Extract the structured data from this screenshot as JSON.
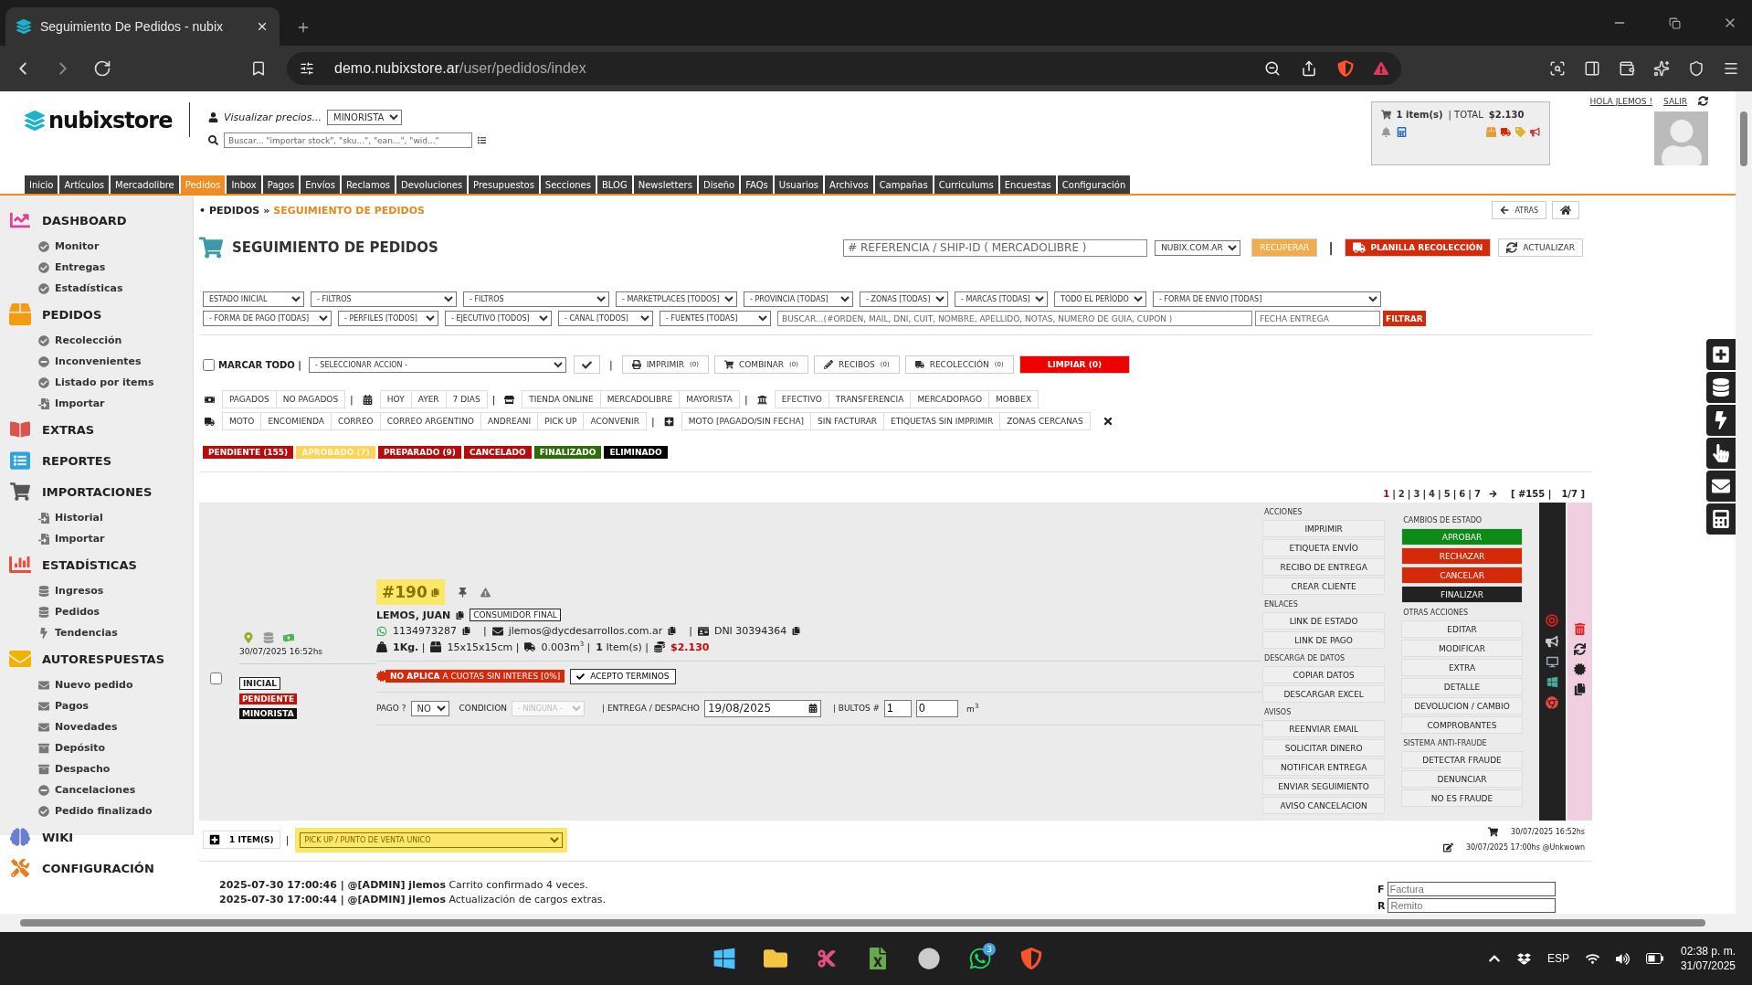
{
  "browser": {
    "tab_title": "Seguimiento De Pedidos - nubix",
    "url_host": "demo.nubixstore.ar",
    "url_path": "/user/pedidos/index"
  },
  "header": {
    "logo": "nubixstore",
    "price_label": "Visualizar precios...",
    "price_option": "MINORISTA",
    "search_placeholder": "Buscar... \"importar stock\", \"sku...\", \"ean...\", \"wid...\"",
    "cart_items": "1 item(s)",
    "cart_total_label": "| TOTAL",
    "cart_total": "$2.130",
    "user_links": [
      "HOLA JLEMOS !",
      "SALIR"
    ]
  },
  "nav": [
    {
      "label": "Inicio",
      "selected": false
    },
    {
      "label": "Artículos",
      "selected": false
    },
    {
      "label": "Mercadolibre",
      "selected": false
    },
    {
      "label": "Pedidos",
      "selected": true
    },
    {
      "label": "Inbox",
      "selected": false
    },
    {
      "label": "Pagos",
      "selected": false
    },
    {
      "label": "Envíos",
      "selected": false
    },
    {
      "label": "Reclamos",
      "selected": false
    },
    {
      "label": "Devoluciones",
      "selected": false
    },
    {
      "label": "Presupuestos",
      "selected": false
    },
    {
      "label": "Secciones",
      "selected": false
    },
    {
      "label": "BLOG",
      "selected": false
    },
    {
      "label": "Newsletters",
      "selected": false
    },
    {
      "label": "Diseño",
      "selected": false
    },
    {
      "label": "FAQs",
      "selected": false
    },
    {
      "label": "Usuarios",
      "selected": false
    },
    {
      "label": "Archivos",
      "selected": false
    },
    {
      "label": "Campañas",
      "selected": false
    },
    {
      "label": "Curriculums",
      "selected": false
    },
    {
      "label": "Encuestas",
      "selected": false
    },
    {
      "label": "Configuración",
      "selected": false
    }
  ],
  "sidebar": [
    {
      "title": "DASHBOARD",
      "kind": "dashboard",
      "items": [
        {
          "label": "Monitor",
          "kind": "check"
        },
        {
          "label": "Entregas",
          "kind": "check"
        },
        {
          "label": "Estadísticas",
          "kind": "check"
        }
      ]
    },
    {
      "title": "PEDIDOS",
      "kind": "box",
      "items": [
        {
          "label": "Recolección",
          "kind": "check"
        },
        {
          "label": "Inconvenientes",
          "kind": "minus"
        },
        {
          "label": "Listado por items",
          "kind": "check"
        },
        {
          "label": "Importar",
          "kind": "doc"
        }
      ]
    },
    {
      "title": "EXTRAS",
      "kind": "book"
    },
    {
      "title": "REPORTES",
      "kind": "report"
    },
    {
      "title": "IMPORTACIONES",
      "kind": "cart",
      "items": [
        {
          "label": "Historial",
          "kind": "doc"
        },
        {
          "label": "Importar",
          "kind": "doc"
        }
      ]
    },
    {
      "title": "ESTADÍSTICAS",
      "kind": "chart",
      "items": [
        {
          "label": "Ingresos",
          "kind": "stack"
        },
        {
          "label": "Pedidos",
          "kind": "stack"
        },
        {
          "label": "Tendencias",
          "kind": "bolt"
        }
      ]
    },
    {
      "title": "AUTORESPUESTAS",
      "kind": "mail",
      "items": [
        {
          "label": "Nuevo pedido",
          "kind": "mail"
        },
        {
          "label": "Pagos",
          "kind": "mail"
        },
        {
          "label": "Novedades",
          "kind": "mail"
        },
        {
          "label": "Depósito",
          "kind": "box"
        },
        {
          "label": "Despacho",
          "kind": "box"
        },
        {
          "label": "Cancelaciones",
          "kind": "minus"
        },
        {
          "label": "Pedido finalizado",
          "kind": "check"
        }
      ]
    },
    {
      "title": "WIKI",
      "kind": "brain"
    },
    {
      "title": "CONFIGURACIÓN",
      "kind": "tools"
    }
  ],
  "breadcrumb": {
    "bullet": "•",
    "parent": "PEDIDOS",
    "separator": "»",
    "current": "SEGUIMIENTO DE PEDIDOS",
    "back": "ATRAS"
  },
  "title": "SEGUIMIENTO DE PEDIDOS",
  "reference": {
    "placeholder": "# REFERENCIA / SHIP-ID ( MERCADOLIBRE )",
    "site": "NUBIX.COM.AR",
    "recover": "RECUPERAR",
    "separator": "|",
    "pickup_sheet": "PLANILLA RECOLECCIÓN",
    "refresh": "ACTUALIZAR"
  },
  "filters_row1": [
    "ESTADO INICIAL",
    "- FILTROS",
    "- FILTROS",
    "- MARKETPLACES [TODOS]",
    "- PROVINCIA [TODAS]",
    "- ZONAS [TODAS]",
    "- MARCAS [TODAS]",
    "TODO EL PERÍODO",
    "- FORMA DE ENVIO [TODAS]"
  ],
  "filters_row2": [
    "- FORMA DE PAGO [TODAS]",
    "- PERFILES [TODOS]",
    "- EJECUTIVO [TODOS]",
    "- CANAL [TODOS]",
    "- FUENTES [TODAS]"
  ],
  "search_placeholder": "BUSCAR...(#ORDEN, MAIL, DNI, CUIT, NOMBRE, APELLIDO, NOTAS, NUMERO DE GUIA, CUPON )",
  "date_placeholder": "FECHA ENTREGA",
  "filter_button": "FILTRAR",
  "bulk": {
    "select_all": "MARCAR TODO |",
    "checked": false,
    "action": "- SELECCIONAR ACCION -",
    "separator": "|",
    "buttons": [
      {
        "kind": "print",
        "label": "IMPRIMIR",
        "count": "(0)"
      },
      {
        "kind": "combine",
        "label": "COMBINAR",
        "count": "(0)"
      },
      {
        "kind": "receipt",
        "label": "RECIBOS",
        "count": "(0)"
      },
      {
        "kind": "truck",
        "label": "RECOLECCIÓN",
        "count": "(0)"
      }
    ],
    "clear": "LIMPIAR (0)"
  },
  "quick_filters": [
    [
      {
        "kind": "money",
        "buttons": [
          "PAGADOS",
          "NO PAGADOS"
        ]
      },
      {
        "kind": "calendar",
        "lead": "|",
        "buttons": [
          "HOY",
          "AYER",
          "7 DIAS"
        ]
      },
      {
        "kind": "store",
        "lead": "|",
        "buttons": [
          "TIENDA ONLINE",
          "MERCADOLIBRE",
          "MAYORISTA"
        ]
      },
      {
        "kind": "bank",
        "lead": "|",
        "buttons": [
          "EFECTIVO",
          "TRANSFERENCIA",
          "MERCADOPAGO",
          "MOBBEX"
        ]
      }
    ],
    [
      {
        "kind": "truck",
        "buttons": [
          "MOTO",
          "ENCOMIENDA",
          "CORREO",
          "CORREO ARGENTINO",
          "ANDREANI",
          "PICK UP",
          "ACONVENIR"
        ]
      },
      {
        "kind": "plus",
        "lead": "|",
        "buttons": [
          "MOTO [PAGADO/SIN FECHA]",
          "SIN FACTURAR",
          "ETIQUETAS SIN IMPRIMIR",
          "ZONAS CERCANAS"
        ],
        "clear": true
      }
    ]
  ],
  "status_tags": [
    {
      "label": "PENDIENTE (155)",
      "color": "#b50d0d"
    },
    {
      "label": "APROBADO (7)",
      "color": "#fdd35a"
    },
    {
      "label": "PREPARADO (9)",
      "color": "#b50d0d"
    },
    {
      "label": "CANCELADO",
      "color": "#b50d0d"
    },
    {
      "label": "FINALIZADO",
      "color": "#2f6d0a"
    },
    {
      "label": "ELIMINADO",
      "color": "#000000"
    }
  ],
  "pagination": {
    "pages": [
      {
        "label": "1",
        "selected": true,
        "sep": "|"
      },
      {
        "label": "2",
        "selected": false,
        "sep": "|"
      },
      {
        "label": "3",
        "selected": false,
        "sep": "|"
      },
      {
        "label": "4",
        "selected": false,
        "sep": "|"
      },
      {
        "label": "5",
        "selected": false,
        "sep": "|"
      },
      {
        "label": "6",
        "selected": false,
        "sep": "|"
      },
      {
        "label": "7",
        "selected": false
      }
    ],
    "total": "[ #155 |",
    "page_of": "1/7 ]"
  },
  "order": {
    "checked": false,
    "date": "30/07/2025 16:52hs",
    "tags": [
      {
        "label": "INICIAL",
        "kind": "outline"
      },
      {
        "label": "PENDIENTE",
        "kind": "red"
      },
      {
        "label": "MINORISTA",
        "kind": "black"
      }
    ],
    "number": "#190",
    "customer": "LEMOS, JUAN",
    "customer_type": "CONSUMIDOR FINAL",
    "contacts": [
      {
        "kind": "whatsapp",
        "text": "1134973287"
      },
      {
        "kind": "mail",
        "lead": "|",
        "text": "jlemos@dycdesarrollos.com.ar"
      },
      {
        "kind": "id",
        "lead": "|",
        "text": "DNI 30394364"
      }
    ],
    "specs": [
      {
        "kind": "weight",
        "text": "**1Kg.** |"
      },
      {
        "kind": "box",
        "text": "15x15x15cm |"
      },
      {
        "kind": "truck",
        "text": "0.003m$^{3}$ |"
      },
      {
        "kind": "none",
        "text": "**1** Item(s) |"
      },
      {
        "kind": "coins",
        "text": "$2.130"
      }
    ],
    "installments": "**NO APLICA** A CUOTAS SIN INTERES [0%]",
    "terms": "ACEPTO TERMINOS",
    "payment_label": "PAGO ?",
    "payment": "NO",
    "condition_label": "CONDICION",
    "condition": "- NINGUNA -",
    "condition_disabled": true,
    "delivery_label": "| ENTREGA / DESPACHO",
    "delivery_date": "19/08/2025",
    "packages_label": "| BULTOS #",
    "packages": "1",
    "volume": "0",
    "volume_unit": "m$^{3}$",
    "action_columns": [
      [
        {
          "title": "ACCIONES",
          "buttons": [
            {
              "label": "IMPRIMIR"
            },
            {
              "label": "ETIQUETA ENVÍO"
            },
            {
              "label": "RECIBO DE ENTREGA"
            },
            {
              "label": "CREAR CLIENTE"
            }
          ]
        },
        {
          "title": "ENLACES",
          "buttons": [
            {
              "label": "LINK DE ESTADO"
            },
            {
              "label": "LINK DE PAGO"
            }
          ]
        },
        {
          "title": "DESCARGA DE DATOS",
          "buttons": [
            {
              "label": "COPIAR DATOS"
            },
            {
              "label": "DESCARGAR EXCEL"
            }
          ]
        },
        {
          "title": "AVISOS",
          "buttons": [
            {
              "label": "REENVIAR EMAIL"
            },
            {
              "label": "SOLICITAR DINERO"
            },
            {
              "label": "NOTIFICAR ENTREGA"
            },
            {
              "label": "ENVIAR SEGUIMIENTO"
            },
            {
              "label": "AVISO CANCELACION"
            }
          ]
        }
      ],
      [
        {
          "title": "CAMBIOS DE ESTADO",
          "buttons": [
            {
              "label": "APROBAR",
              "color": "#0e8a16"
            },
            {
              "label": "RECHAZAR",
              "color": "#d42a0a"
            },
            {
              "label": "CANCELAR",
              "color": "#d42a0a"
            },
            {
              "label": "FINALIZAR",
              "color": "#222222"
            }
          ]
        },
        {
          "title": "OTRAS ACCIONES",
          "buttons": [
            {
              "label": "EDITAR"
            },
            {
              "label": "MODIFICAR"
            },
            {
              "label": "EXTRA"
            },
            {
              "label": "DETALLE"
            },
            {
              "label": "DEVOLUCION / CAMBIO"
            },
            {
              "label": "COMPROBANTES"
            }
          ]
        },
        {
          "title": "SISTEMA ANTI-FRAUDE",
          "buttons": [
            {
              "label": "DETECTAR FRAUDE"
            },
            {
              "label": "DENUNCIAR"
            },
            {
              "label": "NO ES FRAUDE"
            }
          ]
        }
      ]
    ],
    "items_button": "1 ITEM(S)",
    "footer_separator": "|",
    "shipping": "PICK UP / PUNTO DE VENTA UNICO",
    "created": "30/07/2025 16:52hs",
    "edited": "30/07/2025 17:00hs @Unkwown"
  },
  "log": [
    "**2025-07-30 17:00:46 | @[ADMIN] jlemos** Carrito confirmado 4 veces.",
    "**2025-07-30 17:00:44 | @[ADMIN] jlemos** Actualización de cargos extras."
  ],
  "invoices": [
    {
      "letter": "F",
      "placeholder": "Factura"
    },
    {
      "letter": "R",
      "placeholder": "Remito"
    }
  ],
  "taskbar": {
    "whatsapp_badge": "3",
    "language": "ESP",
    "time": "02:38 p. m.",
    "date": "31/07/2025"
  }
}
